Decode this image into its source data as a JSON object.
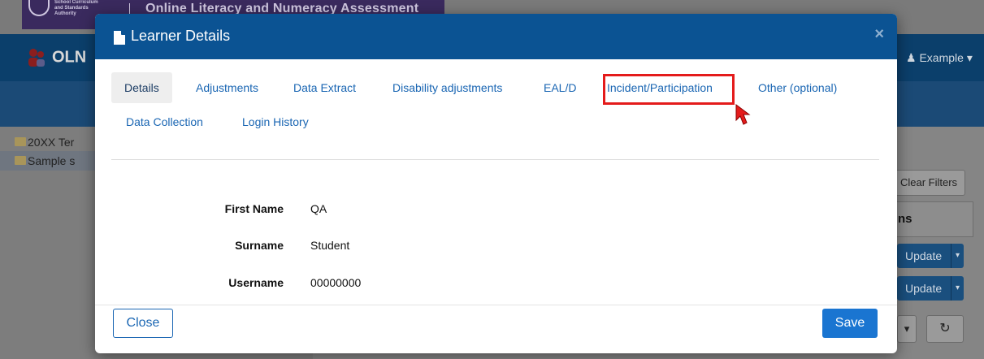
{
  "background": {
    "authority_name": "School Curriculum and Standards Authority",
    "assessment_title": "Online Literacy and Numeracy Assessment",
    "brand_partial": "OLN",
    "user_menu": "Example",
    "tree_items": [
      "20XX Ter",
      "Sample s"
    ],
    "clear_filters_label": "Clear Filters",
    "panel_heading_partial": "ns",
    "update_label": "Update"
  },
  "modal": {
    "title": "Learner Details",
    "tabs": [
      {
        "label": "Details",
        "active": true
      },
      {
        "label": "Adjustments"
      },
      {
        "label": "Data Extract"
      },
      {
        "label": "Disability adjustments"
      },
      {
        "label": "EAL/D"
      },
      {
        "label": "Incident/Participation",
        "highlighted": true
      },
      {
        "label": "Other (optional)"
      },
      {
        "label": "Data Collection"
      },
      {
        "label": "Login History"
      }
    ],
    "fields": [
      {
        "label": "First Name",
        "value": "QA"
      },
      {
        "label": "Surname",
        "value": "Student"
      },
      {
        "label": "Username",
        "value": "00000000"
      }
    ],
    "footer": {
      "close_label": "Close",
      "save_label": "Save"
    }
  },
  "colors": {
    "header": "#0b5393",
    "link": "#1a66b3",
    "primary_button": "#1a75d1",
    "highlight": "#e41b1b"
  }
}
